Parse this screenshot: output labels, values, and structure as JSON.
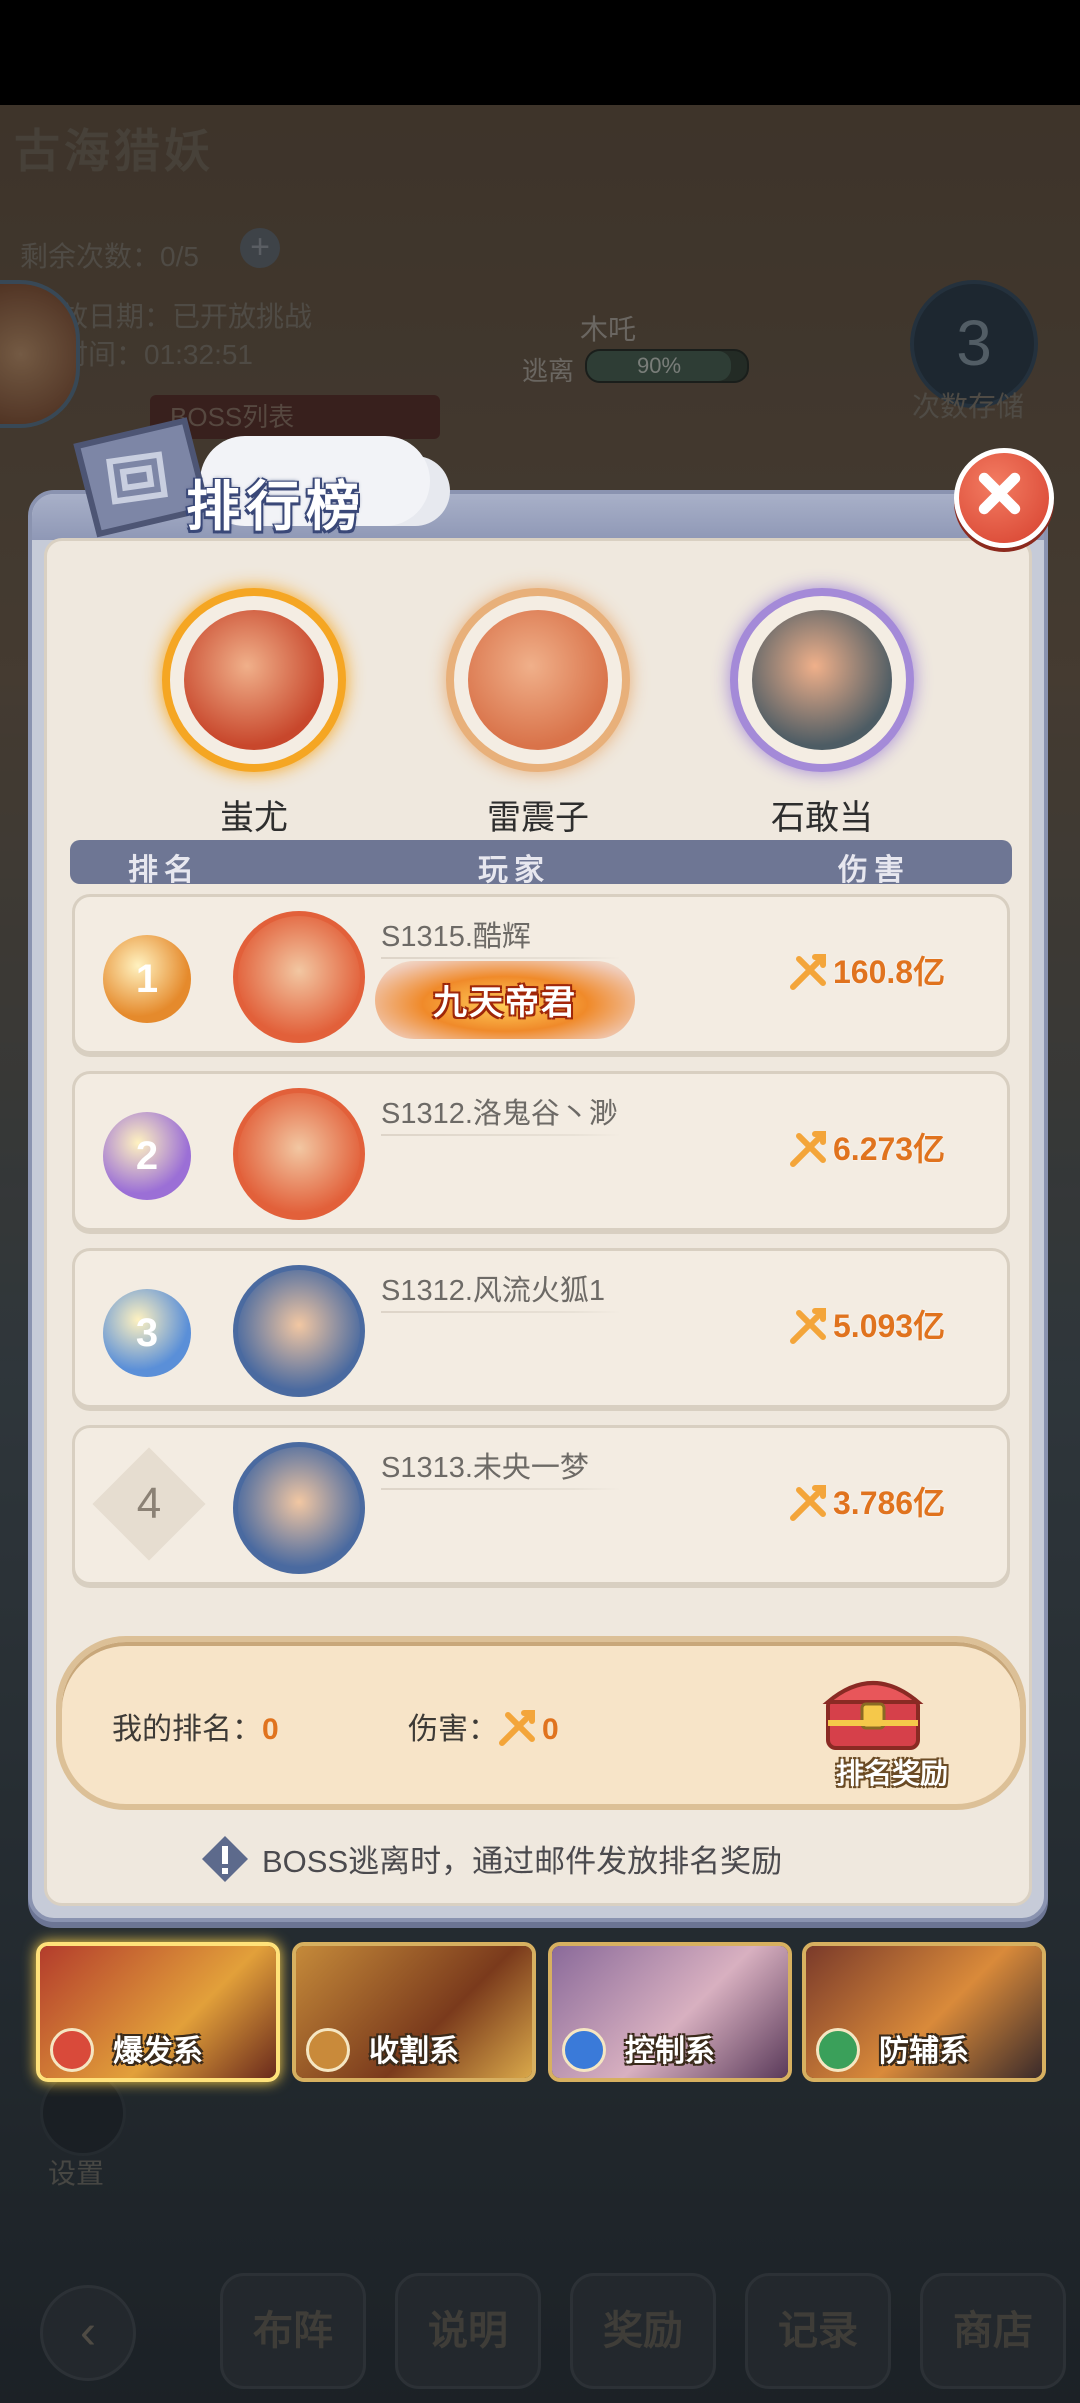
{
  "background": {
    "title": "古海猎妖",
    "remaining_label": "剩余次数：0/5",
    "open_date": "放日期：已开放挑战",
    "time_label": "时间：01:32:51",
    "boss_name": "木吒",
    "escape_label": "逃离",
    "escape_value": "90%",
    "escape_progress": 0.9,
    "count_value": "3",
    "count_label": "次数存储",
    "list_label": "BOSS列表",
    "settings_label": "设置",
    "nav": [
      "布阵",
      "说明",
      "奖励",
      "记录",
      "商店"
    ]
  },
  "modal": {
    "title": "排行榜",
    "bosses": [
      {
        "name": "蚩尤",
        "ring": "#f5a623",
        "face": "#c8472c"
      },
      {
        "name": "雷震子",
        "ring": "#e8b07a",
        "face": "#d9734a"
      },
      {
        "name": "石敢当",
        "ring": "#a48ad8",
        "face": "#4d5c64"
      }
    ],
    "headers": {
      "rank": "排名",
      "player": "玩家",
      "damage": "伤害"
    },
    "rows": [
      {
        "rank": "1",
        "name": "S1315.酷辉",
        "title": "九天帝君",
        "damage": "160.8亿",
        "medal": "#e58a2c",
        "avatar": "#e2603a"
      },
      {
        "rank": "2",
        "name": "S1312.洛鬼谷丶渺",
        "damage": "6.273亿",
        "medal": "#9b6fd6",
        "avatar": "#e2603a"
      },
      {
        "rank": "3",
        "name": "S1312.风流火狐1",
        "damage": "5.093亿",
        "medal": "#5a8fd8",
        "avatar": "#4a6aa0"
      },
      {
        "rank": "4",
        "name": "S1313.未央一梦",
        "damage": "3.786亿",
        "avatar": "#4a6aa0"
      }
    ],
    "my_rank_label": "我的排名：",
    "my_rank_value": "0",
    "my_damage_label": "伤害：",
    "my_damage_value": "0",
    "reward_label": "排名奖励",
    "notice": "BOSS逃离时，通过邮件发放排名奖励"
  },
  "categories": [
    {
      "label": "爆发系",
      "color": "#d94a3a",
      "selected": true
    },
    {
      "label": "收割系",
      "color": "#c98a3a",
      "selected": false
    },
    {
      "label": "控制系",
      "color": "#3a7ad9",
      "selected": false
    },
    {
      "label": "防辅系",
      "color": "#3aa05a",
      "selected": false
    }
  ]
}
